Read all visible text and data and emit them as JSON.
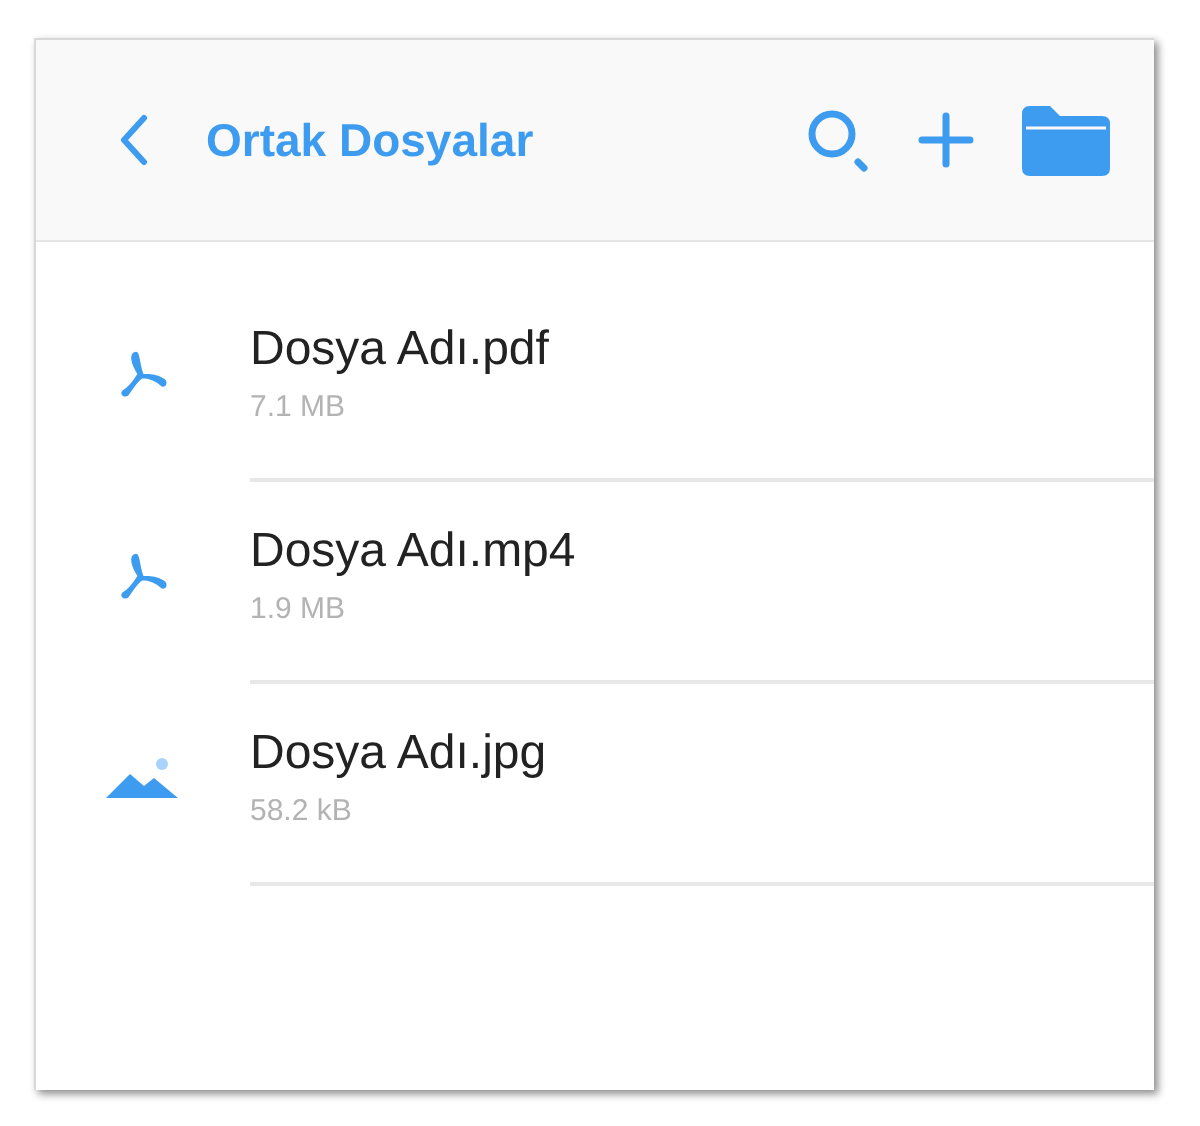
{
  "header": {
    "title": "Ortak Dosyalar"
  },
  "files": [
    {
      "kind": "pdf",
      "name": "Dosya Adı.pdf",
      "size": "7.1 MB"
    },
    {
      "kind": "pdf",
      "name": "Dosya Adı.mp4",
      "size": "1.9 MB"
    },
    {
      "kind": "image",
      "name": "Dosya Adı.jpg",
      "size": "58.2 kB"
    }
  ]
}
